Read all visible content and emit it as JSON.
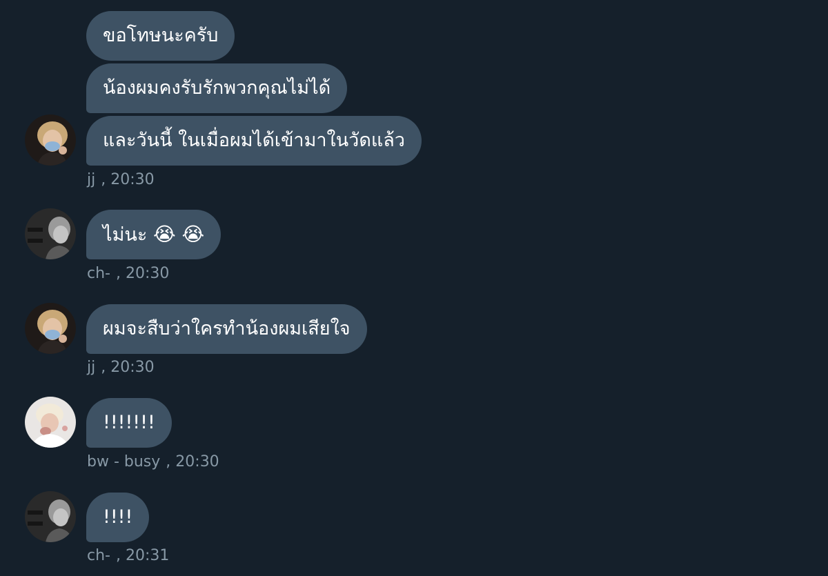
{
  "conversation": {
    "groups": [
      {
        "sender": "jj",
        "time": "20:30",
        "avatar": "person-face-mask-icon",
        "messages": [
          "ขอโทษนะครับ",
          "น้องผมคงรับรักพวกคุณไม่ได้",
          "และวันนี้ ในเมื่อผมได้เข้ามาในวัดแล้ว"
        ]
      },
      {
        "sender": "ch-",
        "time": "20:30",
        "avatar": "person-grayscale-icon",
        "messages": [
          {
            "text": "ไม่นะ",
            "emoji": "😭 😭"
          }
        ]
      },
      {
        "sender": "jj",
        "time": "20:30",
        "avatar": "person-face-mask-icon",
        "messages": [
          "ผมจะสืบว่าใครทำน้องผมเสียใจ"
        ]
      },
      {
        "sender": "bw - busy",
        "time": "20:30",
        "avatar": "person-blonde-icon",
        "messages": [
          "!!!!!!!"
        ]
      },
      {
        "sender": "ch-",
        "time": "20:31",
        "avatar": "person-grayscale-icon",
        "messages": [
          "!!!!"
        ]
      }
    ]
  },
  "colors": {
    "background": "#15202b",
    "bubble": "#3e5264",
    "meta_text": "#8899a6"
  }
}
